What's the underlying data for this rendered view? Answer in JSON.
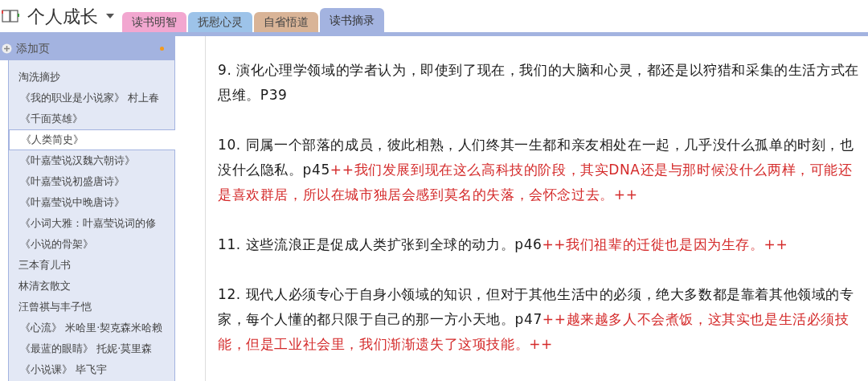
{
  "notebook": {
    "title": "个人成长"
  },
  "tabs": [
    {
      "label": "读书明智",
      "color": "#f2a7d0",
      "selected": false
    },
    {
      "label": "抚慰心灵",
      "color": "#9dc3e9",
      "selected": false
    },
    {
      "label": "自省悟道",
      "color": "#d9b497",
      "selected": false
    },
    {
      "label": "读书摘录",
      "color": "#a3b3e0",
      "selected": true
    }
  ],
  "sidebar": {
    "add_page": "添加页",
    "items": [
      {
        "label": "淘洗摘抄",
        "kind": "section",
        "selected": false
      },
      {
        "label": "《我的职业是小说家》 村上春",
        "kind": "page",
        "selected": false
      },
      {
        "label": "《千面英雄》",
        "kind": "page",
        "selected": false
      },
      {
        "label": "《人类简史》",
        "kind": "page",
        "selected": true
      },
      {
        "label": "《叶嘉莹说汉魏六朝诗》",
        "kind": "page",
        "selected": false
      },
      {
        "label": "《叶嘉莹说初盛唐诗》",
        "kind": "page",
        "selected": false
      },
      {
        "label": "《叶嘉莹说中晚唐诗》",
        "kind": "page",
        "selected": false
      },
      {
        "label": "《小词大雅：叶嘉莹说词的修",
        "kind": "page",
        "selected": false
      },
      {
        "label": "《小说的骨架》",
        "kind": "page",
        "selected": false
      },
      {
        "label": "三本育儿书",
        "kind": "section",
        "selected": false
      },
      {
        "label": "林清玄散文",
        "kind": "section",
        "selected": false
      },
      {
        "label": "汪曾祺与丰子恺",
        "kind": "section",
        "selected": false
      },
      {
        "label": "《心流》 米哈里·契克森米哈赖",
        "kind": "page",
        "selected": false
      },
      {
        "label": "《最蓝的眼睛》 托妮·莫里森",
        "kind": "page",
        "selected": false
      },
      {
        "label": "《小说课》 毕飞宇",
        "kind": "page",
        "selected": false
      }
    ]
  },
  "paragraphs": [
    [
      {
        "text": "9. 演化心理学领域的学者认为，即使到了现在，我们的大脑和心灵，都还是以狩猎和采集的生活方式在思维。P39",
        "kind": "quote"
      }
    ],
    [
      {
        "text": "10. 同属一个部落的成员，彼此相熟，人们终其一生都和亲友相处在一起，几乎没什么孤单的时刻，也没什么隐私。p45",
        "kind": "quote"
      },
      {
        "text": "++我们发展到现在这么高科技的阶段，其实DNA还是与那时候没什么两样，可能还是喜欢群居，所以在城市独居会感到莫名的失落，会怀念过去。++",
        "kind": "note"
      }
    ],
    [
      {
        "text": "11. 这些流浪正是促成人类扩张到全球的动力。p46",
        "kind": "quote"
      },
      {
        "text": "++我们祖辈的迁徙也是因为生存。++",
        "kind": "note"
      }
    ],
    [
      {
        "text": "12. 现代人必须专心于自身小领域的知识，但对于其他生活中的必须，绝大多数都是靠着其他领域的专家，每个人懂的都只限于自己的那一方小天地。p47",
        "kind": "quote"
      },
      {
        "text": "++越来越多人不会煮饭，这其实也是生活必须技能，但是工业社会里，我们渐渐遗失了这项技能。++",
        "kind": "note"
      }
    ]
  ]
}
